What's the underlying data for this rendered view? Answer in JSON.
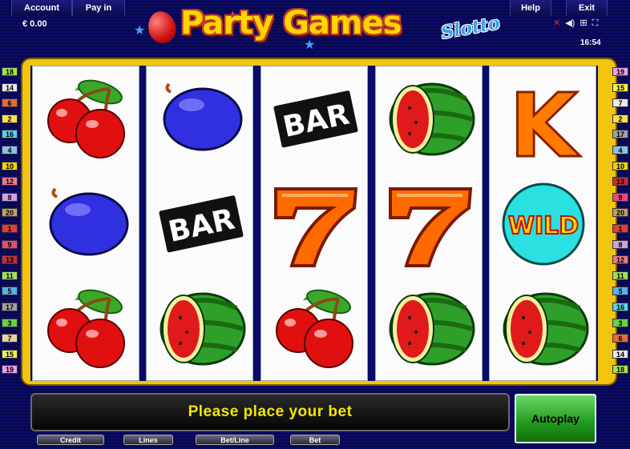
{
  "topbar": {
    "account_label": "Account",
    "payin_label": "Pay in",
    "help_label": "Help",
    "exit_label": "Exit"
  },
  "balance": "€ 0.00",
  "clock": "16:54",
  "logo": {
    "title": "Party Games",
    "subtitle": "Slotto"
  },
  "icons": [
    "mute-icon",
    "sound-icon",
    "settings-icon",
    "fullscreen-icon"
  ],
  "lines_left": [
    {
      "n": "18",
      "color": "#a8e04a"
    },
    {
      "n": "14",
      "color": "#e8e8e8"
    },
    {
      "n": "6",
      "color": "#e86a3a"
    },
    {
      "n": "2",
      "color": "#f4e04a"
    },
    {
      "n": "16",
      "color": "#5ad0e8"
    },
    {
      "n": "4",
      "color": "#8ac0e8"
    },
    {
      "n": "10",
      "color": "#f4d000"
    },
    {
      "n": "12",
      "color": "#e87a8a"
    },
    {
      "n": "8",
      "color": "#d0a0e0"
    },
    {
      "n": "20",
      "color": "#c0a060"
    },
    {
      "n": "1",
      "color": "#e83a3a"
    },
    {
      "n": "9",
      "color": "#e84a7a"
    },
    {
      "n": "13",
      "color": "#c0303a"
    },
    {
      "n": "11",
      "color": "#a0e060"
    },
    {
      "n": "5",
      "color": "#5ab0e8"
    },
    {
      "n": "17",
      "color": "#a0a0a0"
    },
    {
      "n": "3",
      "color": "#6ad04a"
    },
    {
      "n": "7",
      "color": "#e8d0a0"
    },
    {
      "n": "15",
      "color": "#f4f04a"
    },
    {
      "n": "19",
      "color": "#e8a0e0"
    }
  ],
  "lines_right": [
    {
      "n": "19",
      "color": "#e8a0e0"
    },
    {
      "n": "15",
      "color": "#f4f04a"
    },
    {
      "n": "7",
      "color": "#e8e8e8"
    },
    {
      "n": "2",
      "color": "#f4e04a"
    },
    {
      "n": "17",
      "color": "#a0a0a0"
    },
    {
      "n": "4",
      "color": "#8ac0e8"
    },
    {
      "n": "10",
      "color": "#f4d000"
    },
    {
      "n": "13",
      "color": "#c0303a"
    },
    {
      "n": "9",
      "color": "#e84a7a"
    },
    {
      "n": "20",
      "color": "#c0a060"
    },
    {
      "n": "1",
      "color": "#e83a3a"
    },
    {
      "n": "8",
      "color": "#d0a0e0"
    },
    {
      "n": "12",
      "color": "#e87a8a"
    },
    {
      "n": "11",
      "color": "#a0e060"
    },
    {
      "n": "5",
      "color": "#5ab0e8"
    },
    {
      "n": "16",
      "color": "#5ad0e8"
    },
    {
      "n": "3",
      "color": "#6ad04a"
    },
    {
      "n": "6",
      "color": "#e86a3a"
    },
    {
      "n": "14",
      "color": "#e8e8e8"
    },
    {
      "n": "18",
      "color": "#a8e04a"
    }
  ],
  "reels": [
    [
      "cherry",
      "plum",
      "cherry"
    ],
    [
      "plum",
      "bar",
      "watermelon"
    ],
    [
      "bar",
      "seven",
      "cherry"
    ],
    [
      "watermelon",
      "seven",
      "watermelon"
    ],
    [
      "king",
      "wild",
      "watermelon"
    ]
  ],
  "symbol_text": {
    "bar": "BAR",
    "king": "K",
    "wild": "WILD"
  },
  "message": "Please place your bet",
  "autoplay_label": "Autoplay",
  "bottom_labels": {
    "credit": "Credit",
    "lines": "Lines",
    "bet_line": "Bet/Line",
    "bet": "Bet"
  }
}
